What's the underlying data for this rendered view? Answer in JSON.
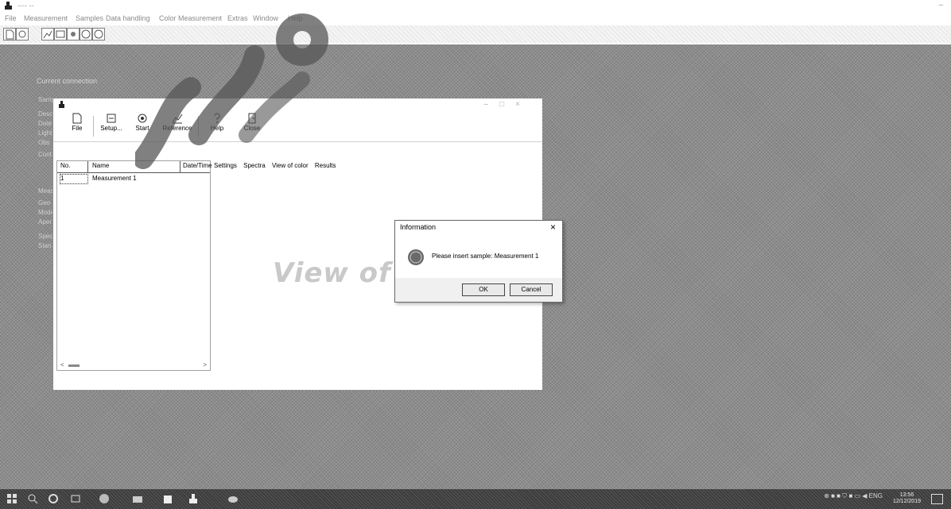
{
  "app": {
    "title": "---- --",
    "menus": [
      "File",
      "Measurement",
      "Samples",
      "Data handling",
      "Color Measurement",
      "Extras",
      "Window",
      "Help"
    ]
  },
  "workspace": {
    "caption": "Current connection",
    "side_labels": [
      "Samp",
      "Desc",
      "Date",
      "Light",
      "Obs",
      "Cont",
      "Meas",
      "Geo",
      "Mode",
      "Aper",
      "Spec",
      "Stan"
    ]
  },
  "inner_window": {
    "toolbar": [
      "File",
      "Setup...",
      "Start",
      "Reference",
      "Help",
      "Close"
    ],
    "list": {
      "columns": [
        "No.",
        "Name",
        "Date/Time"
      ],
      "rows": [
        {
          "no": "1",
          "name": "Measurement 1"
        }
      ]
    },
    "tabs": [
      "Settings",
      "Spectra",
      "View of color",
      "Results"
    ],
    "view_title": "View of"
  },
  "dialog": {
    "title": "Information",
    "message": "Please insert sample: Measurement 1",
    "ok": "OK",
    "cancel": "Cancel"
  },
  "taskbar": {
    "time": "13:56",
    "date": "12/12/2019",
    "lang": "ENG"
  }
}
